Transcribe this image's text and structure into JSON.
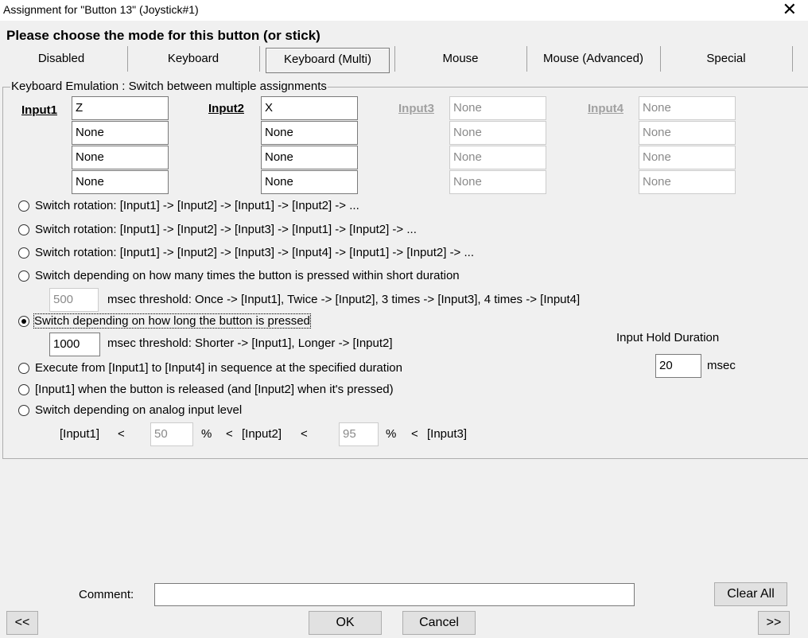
{
  "window": {
    "title": "Assignment for \"Button 13\" (Joystick#1)",
    "close_glyph": "✕"
  },
  "heading": "Please choose the mode for this button (or stick)",
  "tabs": [
    {
      "label": "Disabled",
      "active": false
    },
    {
      "label": "Keyboard",
      "active": false
    },
    {
      "label": "Keyboard (Multi)",
      "active": true
    },
    {
      "label": "Mouse",
      "active": false
    },
    {
      "label": "Mouse (Advanced)",
      "active": false
    },
    {
      "label": "Special",
      "active": false
    }
  ],
  "group_title": "Keyboard Emulation : Switch between multiple assignments",
  "inputs": [
    {
      "label": "Input1",
      "enabled": true,
      "values": [
        "Z",
        "None",
        "None",
        "None"
      ]
    },
    {
      "label": "Input2",
      "enabled": true,
      "values": [
        "X",
        "None",
        "None",
        "None"
      ]
    },
    {
      "label": "Input3",
      "enabled": false,
      "values": [
        "None",
        "None",
        "None",
        "None"
      ]
    },
    {
      "label": "Input4",
      "enabled": false,
      "values": [
        "None",
        "None",
        "None",
        "None"
      ]
    }
  ],
  "modes": [
    {
      "label": "Switch rotation: [Input1] -> [Input2] -> [Input1] -> [Input2] -> ...",
      "checked": false
    },
    {
      "label": "Switch rotation: [Input1] -> [Input2] -> [Input3] -> [Input1] -> [Input2] -> ...",
      "checked": false
    },
    {
      "label": "Switch rotation: [Input1] -> [Input2] -> [Input3] -> [Input4] -> [Input1] -> [Input2] -> ...",
      "checked": false
    },
    {
      "label": "Switch depending on how many times the button is pressed within short duration",
      "checked": false
    },
    {
      "label": "Switch depending on how long the button is pressed",
      "checked": true
    },
    {
      "label": "Execute from [Input1] to [Input4] in sequence at the specified duration",
      "checked": false
    },
    {
      "label": "[Input1] when the button is released (and [Input2] when it's pressed)",
      "checked": false
    },
    {
      "label": "Switch depending on analog input level",
      "checked": false
    }
  ],
  "press_count": {
    "value": "500",
    "text": "msec threshold: Once -> [Input1], Twice -> [Input2], 3 times -> [Input3], 4 times -> [Input4]"
  },
  "press_length": {
    "value": "1000",
    "text": "msec threshold: Shorter -> [Input1], Longer -> [Input2]"
  },
  "hold_duration": {
    "label": "Input Hold Duration",
    "value": "20",
    "unit": "msec"
  },
  "analog": {
    "input1": "[Input1]",
    "lt1": "<",
    "value1": "50",
    "pct1": "%",
    "lt2": "<",
    "input2": "[Input2]",
    "lt3": "<",
    "value2": "95",
    "pct2": "%",
    "lt4": "<",
    "input3": "[Input3]"
  },
  "comment": {
    "label": "Comment:",
    "value": ""
  },
  "buttons": {
    "clear_all": "Clear All",
    "prev": "<<",
    "ok": "OK",
    "cancel": "Cancel",
    "next": ">>"
  }
}
